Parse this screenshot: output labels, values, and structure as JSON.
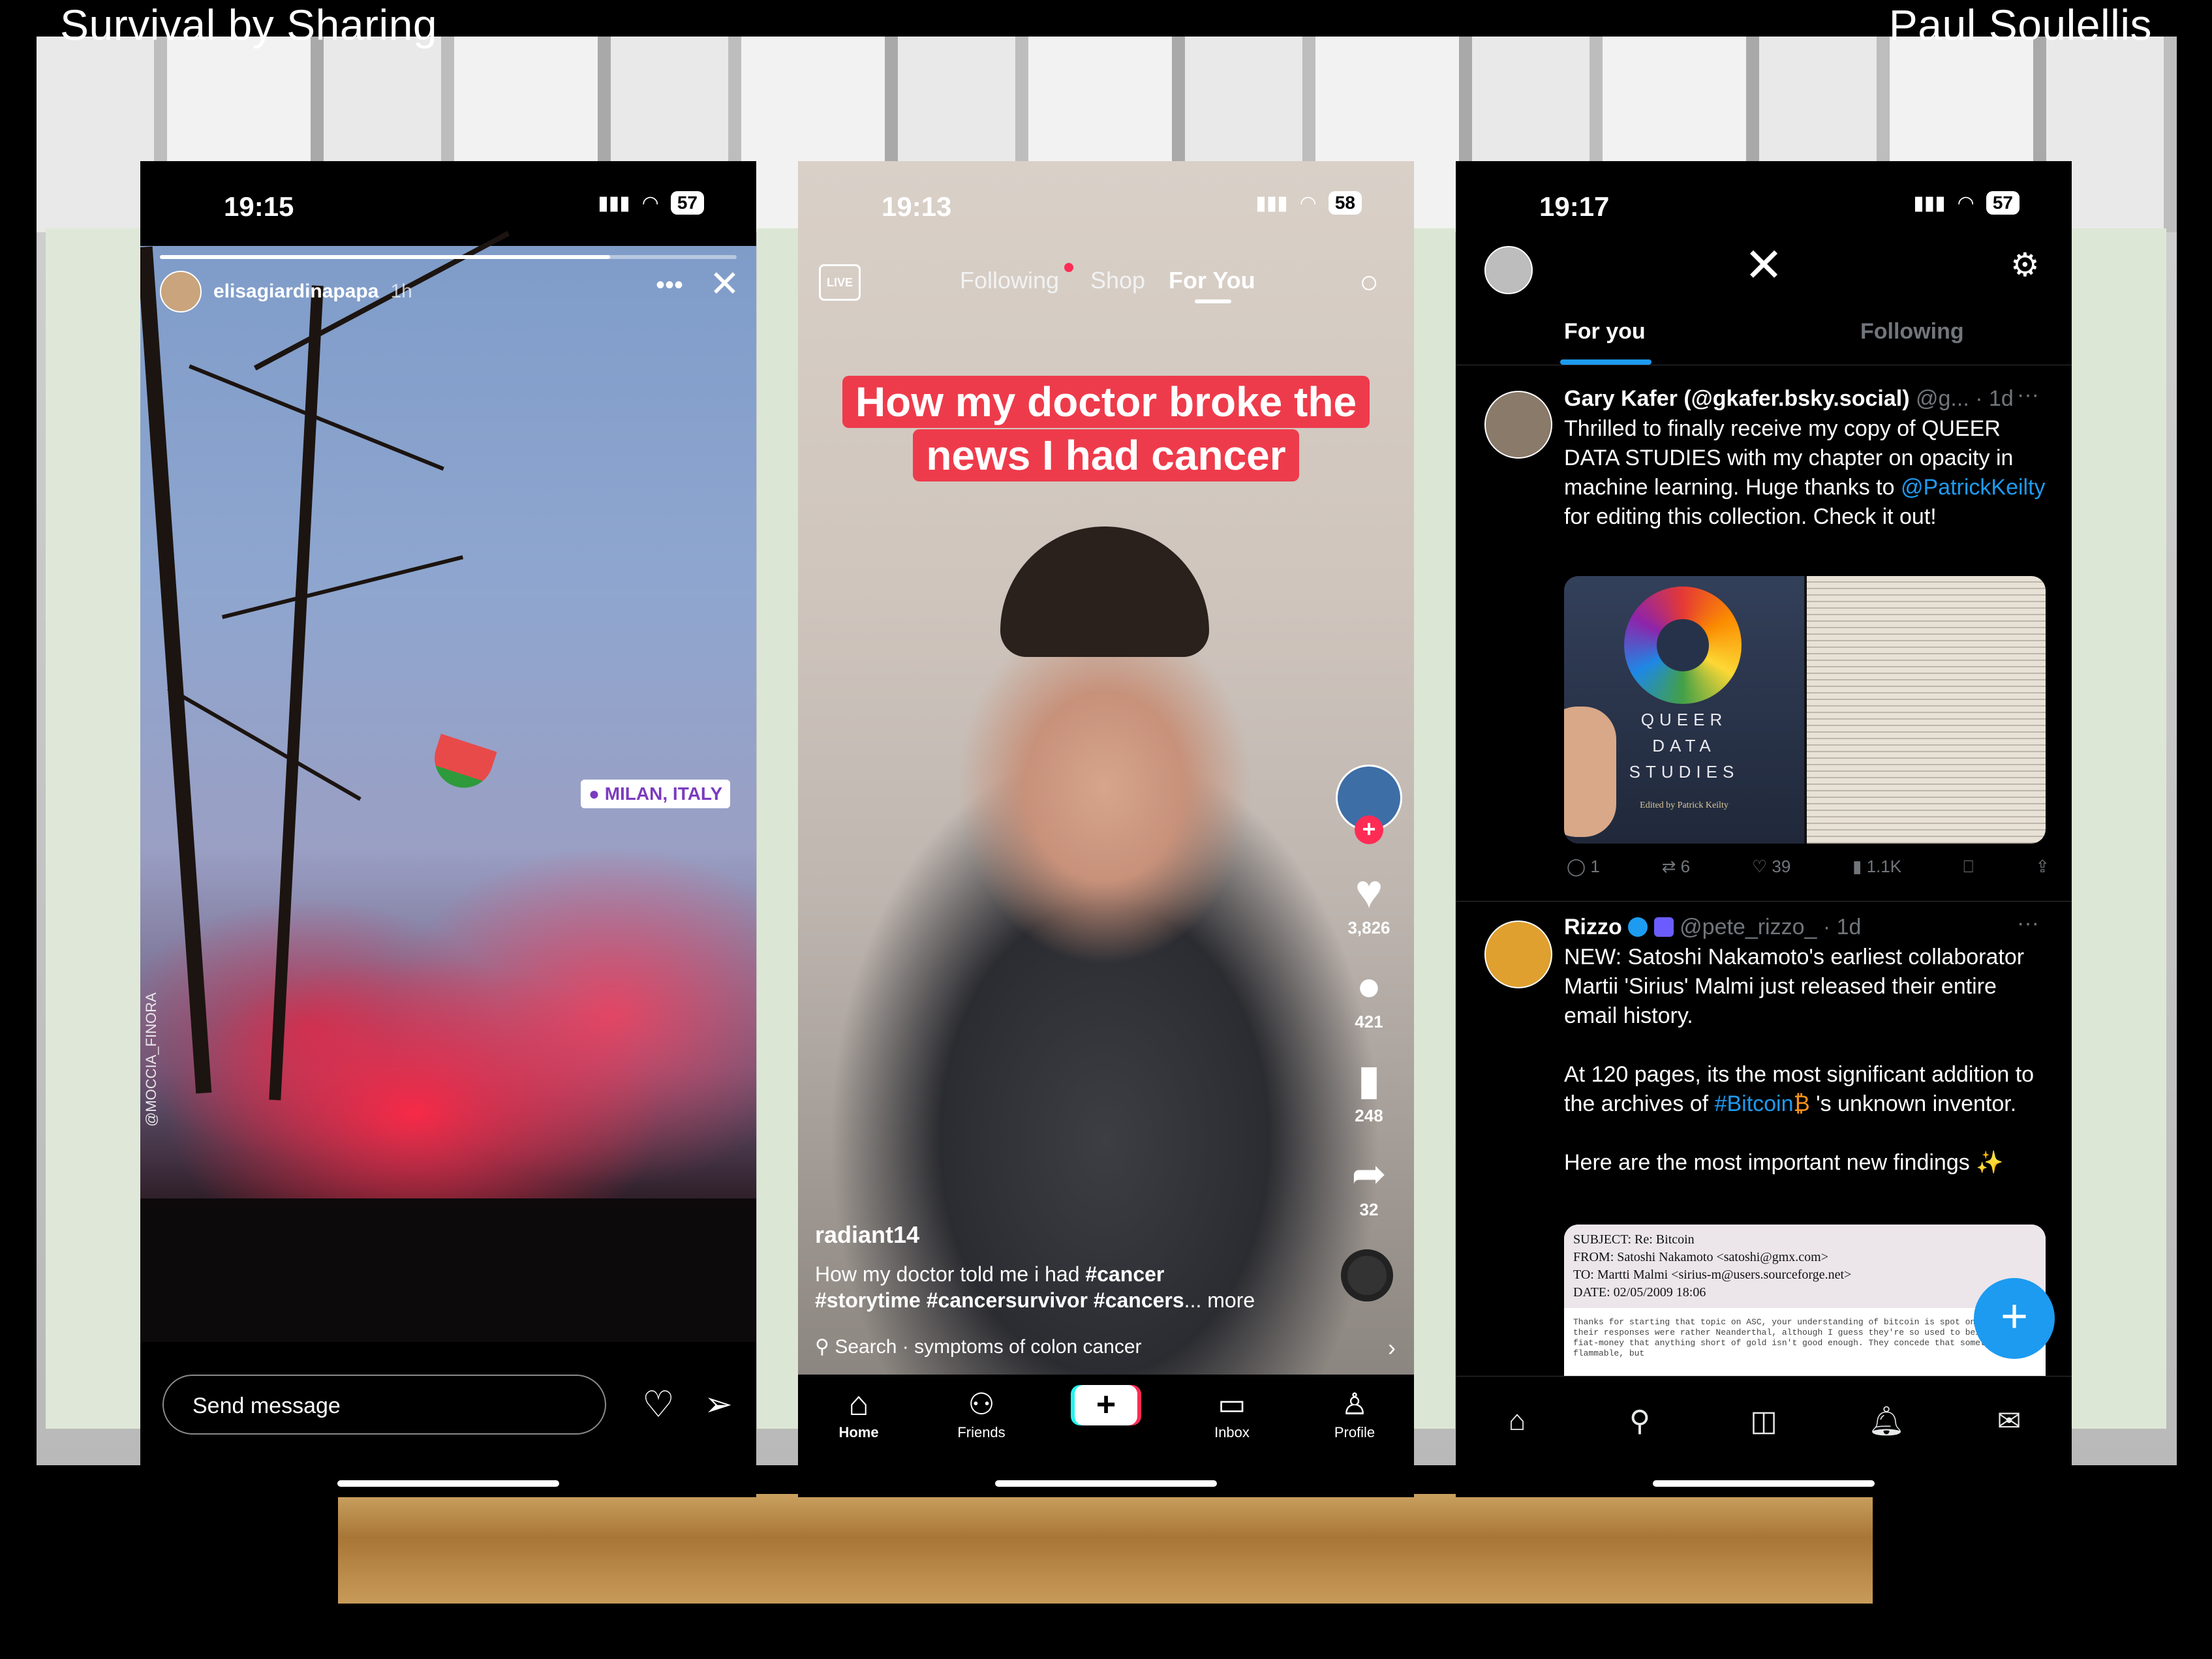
{
  "corners": {
    "left": "Survival by Sharing",
    "right": "Paul Soulellis"
  },
  "instagram": {
    "time": "19:15",
    "battery": "57",
    "username": "elisagiardinapapa",
    "age": "1h",
    "location_sticker": "MILAN, ITALY",
    "photo_credit": "@MOCCIA_FINORA",
    "message_placeholder": "Send message"
  },
  "tiktok": {
    "time": "19:13",
    "battery": "58",
    "live_label": "LIVE",
    "nav": {
      "following": "Following",
      "shop": "Shop",
      "for_you": "For You"
    },
    "caption_line1": "How my doctor broke the",
    "caption_line2": "news I had cancer",
    "likes": "3,826",
    "comments": "421",
    "saves": "248",
    "shares": "32",
    "username": "radiant14",
    "desc_text": "How my doctor told me i had ",
    "desc_tag1": "#cancer",
    "desc_tags2": "#storytime #cancersurvivor #cancers",
    "desc_more": "... more",
    "search_label": "Search ·",
    "search_query": "symptoms of colon cancer",
    "tabs": {
      "home": "Home",
      "friends": "Friends",
      "inbox": "Inbox",
      "profile": "Profile"
    }
  },
  "x": {
    "time": "19:17",
    "battery": "57",
    "tabs": {
      "for_you": "For you",
      "following": "Following"
    },
    "tweet1": {
      "name": "Gary Kafer (@gkafer.bsky.social)",
      "handle": "@g... · 1d",
      "text1": "Thrilled to finally receive my copy of QUEER DATA STUDIES with my chapter on opacity in machine learning. Huge thanks to ",
      "mention": "@PatrickKeilty",
      "text2": " for editing this collection. Check it out!",
      "book_title1": "QUEER",
      "book_title2": "DATA",
      "book_title3": "STUDIES",
      "book_editor": "Edited by Patrick Keilty",
      "replies": "1",
      "reposts": "6",
      "likes": "39",
      "views": "1.1K"
    },
    "tweet2": {
      "name": "Rizzo",
      "handle": "@pete_rizzo_ · 1d",
      "p1": "NEW: Satoshi Nakamoto's earliest collaborator Martii 'Sirius' Malmi just released their entire email history.",
      "p2a": "At 120 pages, its the most significant addition to the archives of ",
      "p2tag": "#Bitcoin",
      "p2b": " 's unknown inventor.",
      "p3": "Here are the most important new findings ✨",
      "email_subject": "SUBJECT: Re: Bitcoin",
      "email_from": "FROM: Satoshi Nakamoto <satoshi@gmx.com>",
      "email_to": "TO: Martti Malmi <sirius-m@users.sourceforge.net>",
      "email_date": "DATE: 02/05/2009 18:06",
      "email_body": "Thanks for starting that topic on ASC, your understanding of bitcoin is spot on.  Some of their responses were rather Neanderthal, although I guess they're so used to being anti-fiat-money that anything short of gold isn't good enough.  They concede that something is flammable, but"
    }
  }
}
